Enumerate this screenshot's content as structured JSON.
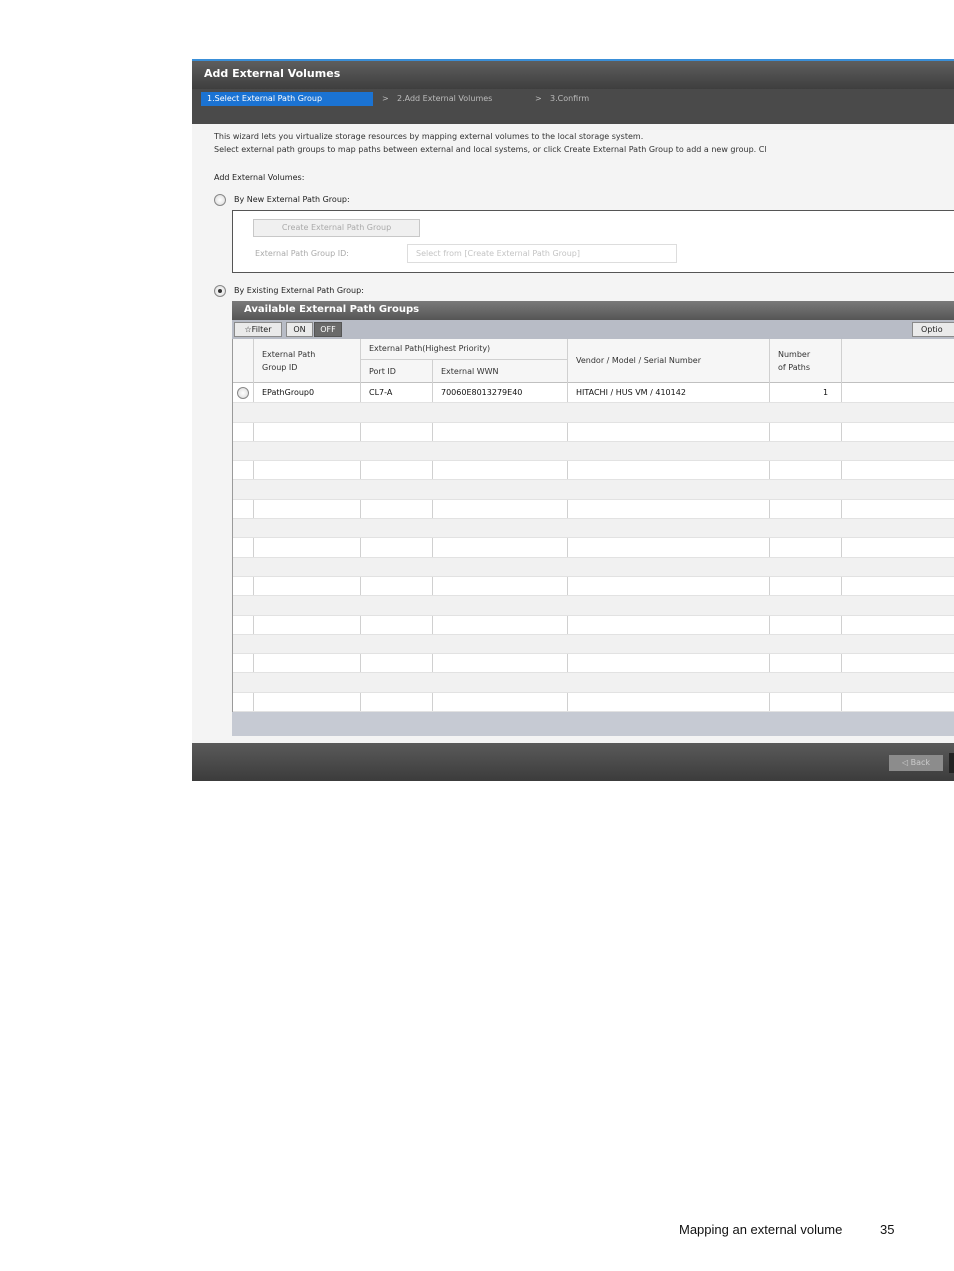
{
  "dialog": {
    "title": "Add External Volumes",
    "steps": [
      {
        "label": "1.Select External Path Group"
      },
      {
        "label": "2.Add External Volumes"
      },
      {
        "label": "3.Confirm"
      }
    ],
    "step_separator": ">",
    "intro_line1": "This wizard lets you virtualize storage resources by mapping external volumes to the local storage system.",
    "intro_line2": "Select external path groups to map paths between external and local systems, or click Create External Path Group to add a new group. Cl",
    "add_label": "Add External Volumes:",
    "option_new": {
      "label": "By New External Path Group:",
      "selected": false,
      "create_button": "Create External Path Group",
      "group_id_label": "External Path Group ID:",
      "group_id_placeholder": "Select from [Create External Path Group]"
    },
    "option_existing": {
      "label": "By Existing External Path Group:",
      "selected": true
    },
    "panel": {
      "title": "Available External Path Groups",
      "filter_label": "☆Filter",
      "filter_on": "ON",
      "filter_off": "OFF",
      "options_label": "Optio",
      "columns": {
        "group_id_line1": "External Path",
        "group_id_line2": "Group ID",
        "path_group_header": "External Path(Highest Priority)",
        "port_id": "Port ID",
        "wwn": "External WWN",
        "vendor": "Vendor / Model / Serial Number",
        "paths_line1": "Number",
        "paths_line2": "of Paths"
      },
      "rows": [
        {
          "group_id": "EPathGroup0",
          "port_id": "CL7-A",
          "wwn": "70060E8013279E40",
          "vendor": "HITACHI / HUS VM / 410142",
          "paths": "1"
        }
      ]
    },
    "back_button": "◁ Back"
  },
  "page_footer": {
    "text": "Mapping an external volume",
    "page_number": "35"
  }
}
